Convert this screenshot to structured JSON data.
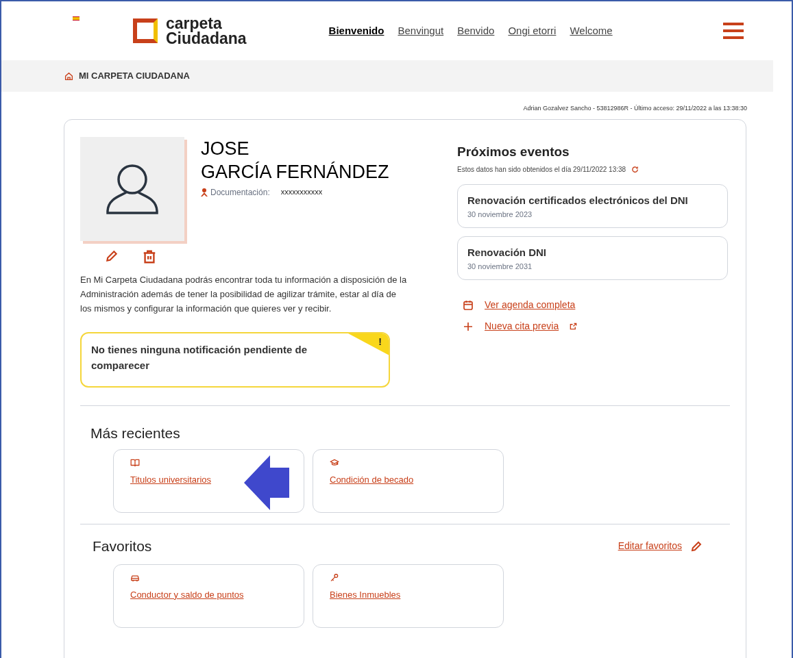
{
  "header": {
    "logo": {
      "line1": "carpeta",
      "line2": "Ciudadana"
    },
    "languages": [
      {
        "label": "Bienvenido",
        "selected": true
      },
      {
        "label": "Benvingut",
        "selected": false
      },
      {
        "label": "Benvido",
        "selected": false
      },
      {
        "label": "Ongi etorri",
        "selected": false
      },
      {
        "label": "Welcome",
        "selected": false
      }
    ]
  },
  "breadcrumb": "MI CARPETA CIUDADANA",
  "last_access": "Adrian Gozalvez Sancho - 53812986R - Último acceso: 29/11/2022 a las 13:38:30",
  "profile": {
    "first_name": "JOSE",
    "last_name": "GARCÍA FERNÁNDEZ",
    "doc_label": "Documentación:",
    "doc_value": "xxxxxxxxxxx",
    "intro": "En Mi Carpeta Ciudadana podrás encontrar toda tu información a disposición de la Administración además de tener la posibilidad de agilizar trámite, estar al día de los mismos y configurar la información que quieres ver y recibir.",
    "notice": "No tienes ninguna notificación pendiente de comparecer",
    "notice_badge": "!"
  },
  "events": {
    "title": "Próximos eventos",
    "updated": "Estos datos han sido obtenidos el día 29/11/2022 13:38",
    "items": [
      {
        "title": "Renovación certificados electrónicos del DNI",
        "date": "30 noviembre 2023"
      },
      {
        "title": "Renovación DNI",
        "date": "30 noviembre 2031"
      }
    ],
    "links": [
      {
        "kind": "calendar",
        "label": "Ver agenda completa",
        "external": false
      },
      {
        "kind": "plus",
        "label": "Nueva cita previa",
        "external": true
      }
    ]
  },
  "recent": {
    "title": "Más recientes",
    "tiles": [
      {
        "kind": "book",
        "label": "Titulos universitarios"
      },
      {
        "kind": "cap",
        "label": "Condición de becado"
      }
    ]
  },
  "favorites": {
    "title": "Favoritos",
    "edit": "Editar favoritos",
    "tiles": [
      {
        "kind": "car",
        "label": "Conductor y saldo de puntos"
      },
      {
        "kind": "key",
        "label": "Bienes Inmuebles"
      }
    ]
  }
}
